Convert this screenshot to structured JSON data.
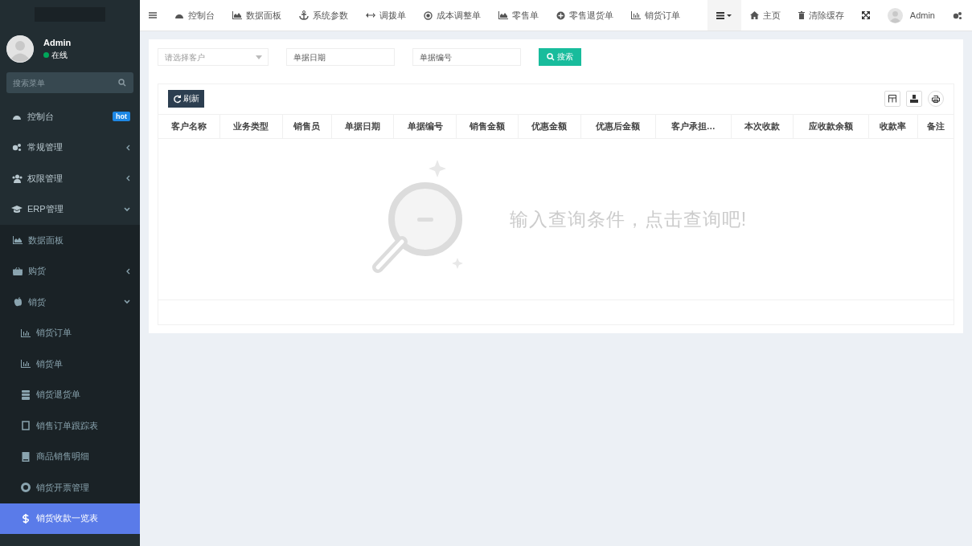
{
  "sidebar": {
    "user": {
      "name": "Admin",
      "status": "在线",
      "online": true
    },
    "search": {
      "placeholder": "搜索菜单"
    },
    "items": [
      {
        "label": "控制台",
        "badge": "hot",
        "selected": false
      },
      {
        "label": "常规管理",
        "expanded": false,
        "selected": false
      },
      {
        "label": "权限管理",
        "expanded": false,
        "selected": false
      },
      {
        "label": "ERP管理",
        "expanded": true,
        "selected": false,
        "children": [
          {
            "label": "数据面板",
            "selected": false
          },
          {
            "label": "购货",
            "expanded": false,
            "selected": false
          },
          {
            "label": "销货",
            "expanded": true,
            "selected": false,
            "children": [
              {
                "label": "销货订单",
                "selected": false
              },
              {
                "label": "销货单",
                "selected": false
              },
              {
                "label": "销货退货单",
                "selected": false
              },
              {
                "label": "销售订单跟踪表",
                "selected": false
              },
              {
                "label": "商品销售明细",
                "selected": false
              },
              {
                "label": "销货开票管理",
                "selected": false
              },
              {
                "label": "销货收款一览表",
                "selected": true
              }
            ]
          }
        ]
      }
    ]
  },
  "topbar": {
    "tabs": [
      {
        "label": "控制台"
      },
      {
        "label": "数据面板"
      },
      {
        "label": "系统参数"
      },
      {
        "label": "调拨单"
      },
      {
        "label": "成本调整单"
      },
      {
        "label": "零售单"
      },
      {
        "label": "零售退货单"
      },
      {
        "label": "销货订单"
      }
    ],
    "links": [
      {
        "label": "主页"
      },
      {
        "label": "清除缓存"
      }
    ],
    "user": "Admin"
  },
  "filters": {
    "customer": {
      "placeholder": "请选择客户"
    },
    "date": {
      "placeholder": "单据日期"
    },
    "number": {
      "placeholder": "单据编号"
    },
    "search_button": "搜索"
  },
  "table": {
    "refresh_button": "刷新",
    "columns": [
      "客户名称",
      "业务类型",
      "销售员",
      "单据日期",
      "单据编号",
      "销售金额",
      "优惠金额",
      "优惠后金额",
      "客户承担…",
      "本次收款",
      "应收款余额",
      "收款率",
      "备注"
    ],
    "empty_message": "输入查询条件，点击查询吧!"
  }
}
